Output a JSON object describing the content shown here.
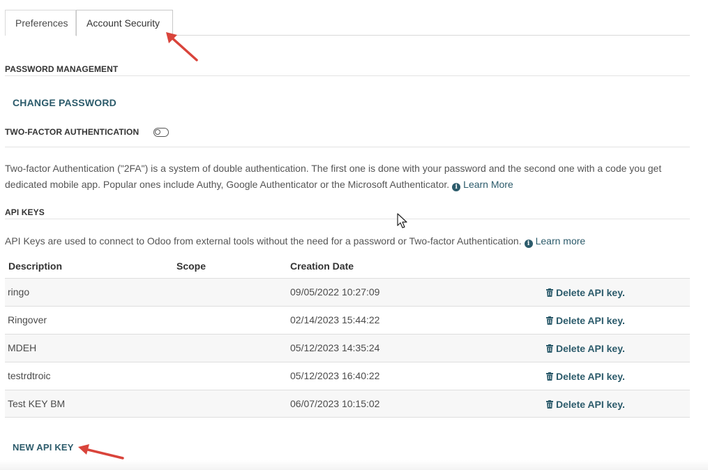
{
  "tabs": [
    {
      "label": "Preferences"
    },
    {
      "label": "Account Security",
      "active": true
    }
  ],
  "password_management": {
    "title": "PASSWORD MANAGEMENT",
    "change_password_label": "CHANGE PASSWORD"
  },
  "two_factor": {
    "title": "TWO-FACTOR AUTHENTICATION",
    "enabled": false,
    "description_line1": "Two-factor Authentication (\"2FA\") is a system of double authentication. The first one is done with your password and the second one with a code you get",
    "description_line2": "dedicated mobile app. Popular ones include Authy, Google Authenticator or the Microsoft Authenticator.",
    "learn_more_label": "Learn More",
    "info_icon": "info-circle-icon"
  },
  "api_keys": {
    "title": "API KEYS",
    "description": "API Keys are used to connect to Odoo from external tools without the need for a password or Two-factor Authentication.",
    "learn_more_label": "Learn more",
    "columns": [
      "Description",
      "Scope",
      "Creation Date"
    ],
    "rows": [
      {
        "description": "ringo",
        "scope": "",
        "creation_date": "09/05/2022 10:27:09",
        "delete_label": "Delete API key."
      },
      {
        "description": "Ringover",
        "scope": "",
        "creation_date": "02/14/2023 15:44:22",
        "delete_label": "Delete API key."
      },
      {
        "description": "MDEH",
        "scope": "",
        "creation_date": "05/12/2023 14:35:24",
        "delete_label": "Delete API key."
      },
      {
        "description": "testrdtroic",
        "scope": "",
        "creation_date": "05/12/2023 16:40:22",
        "delete_label": "Delete API key."
      },
      {
        "description": "Test KEY BM",
        "scope": "",
        "creation_date": "06/07/2023 10:15:02",
        "delete_label": "Delete API key."
      }
    ],
    "new_key_label": "NEW API KEY"
  },
  "colors": {
    "link": "#2c5b6b",
    "annotation_arrow": "#d9443b"
  }
}
